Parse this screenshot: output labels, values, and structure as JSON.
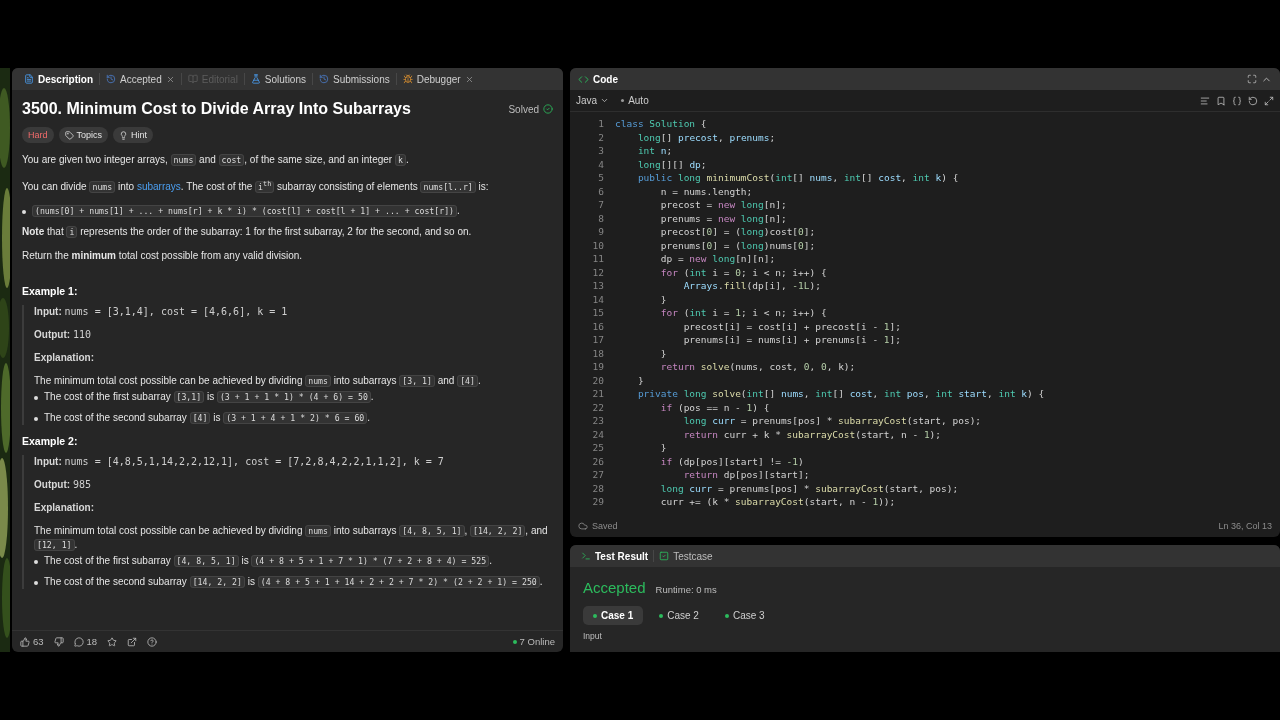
{
  "description_panel": {
    "tabs": [
      {
        "label": "Description",
        "selected": true,
        "disabled": false,
        "closable": false
      },
      {
        "label": "Accepted",
        "selected": false,
        "disabled": false,
        "closable": true
      },
      {
        "label": "Editorial",
        "selected": false,
        "disabled": true,
        "closable": false
      },
      {
        "label": "Solutions",
        "selected": false,
        "disabled": false,
        "closable": false
      },
      {
        "label": "Submissions",
        "selected": false,
        "disabled": false,
        "closable": false
      },
      {
        "label": "Debugger",
        "selected": false,
        "disabled": false,
        "closable": true
      }
    ],
    "title": "3500. Minimum Cost to Divide Array Into Subarrays",
    "status": "Solved",
    "tags": [
      {
        "label": "Hard",
        "kind": "difficulty"
      },
      {
        "label": "Topics",
        "kind": "topics"
      },
      {
        "label": "Hint",
        "kind": "hint"
      }
    ],
    "content": [
      {
        "kind": "paragraph",
        "parts": [
          {
            "kind": "text",
            "text": "You are given two integer arrays, "
          },
          {
            "kind": "code",
            "text": "nums"
          },
          {
            "kind": "text",
            "text": " and "
          },
          {
            "kind": "code",
            "text": "cost"
          },
          {
            "kind": "text",
            "text": ", of the same size, and an integer "
          },
          {
            "kind": "code",
            "text": "k"
          },
          {
            "kind": "text",
            "text": "."
          }
        ]
      },
      {
        "kind": "paragraph",
        "parts": [
          {
            "kind": "text",
            "text": "You can divide "
          },
          {
            "kind": "code",
            "text": "nums"
          },
          {
            "kind": "text",
            "text": " into "
          },
          {
            "kind": "link",
            "text": "subarrays"
          },
          {
            "kind": "text",
            "text": ". The cost of the "
          },
          {
            "kind": "code",
            "text": "i$^{th}$"
          },
          {
            "kind": "text",
            "text": " subarray consisting of elements "
          },
          {
            "kind": "code",
            "text": "nums[l..r]"
          },
          {
            "kind": "text",
            "text": " is:"
          }
        ]
      },
      {
        "kind": "bullet",
        "parts": [
          {
            "kind": "code",
            "text": "(nums[0] + nums[1] + ... + nums[r] + k * i) * (cost[l] + cost[l + 1] + ... + cost[r])"
          },
          {
            "kind": "text",
            "text": "."
          }
        ]
      },
      {
        "kind": "paragraph",
        "parts": [
          {
            "kind": "text",
            "text": "**Note** that "
          },
          {
            "kind": "code",
            "text": "i"
          },
          {
            "kind": "text",
            "text": " represents the order of the subarray: 1 for the first subarray, 2 for the second, and so on."
          }
        ]
      },
      {
        "kind": "paragraph",
        "parts": [
          {
            "kind": "text",
            "text": "Return the **minimum** total cost possible from any valid division."
          }
        ]
      }
    ],
    "examples": [
      {
        "title": "Example 1:",
        "input_label": "Input:",
        "input": "nums = [3,1,4], cost = [4,6,6], k = 1",
        "output_label": "Output:",
        "output": "110",
        "explanation_label": "Explanation:",
        "explanation": [
          {
            "kind": "text",
            "text": "The minimum total cost possible can be achieved by dividing "
          },
          {
            "kind": "code",
            "text": "nums"
          },
          {
            "kind": "text",
            "text": " into subarrays "
          },
          {
            "kind": "code",
            "text": "[3, 1]"
          },
          {
            "kind": "text",
            "text": " and "
          },
          {
            "kind": "code",
            "text": "[4]"
          },
          {
            "kind": "text",
            "text": "."
          }
        ],
        "bullets": [
          [
            {
              "kind": "text",
              "text": "The cost of the first subarray "
            },
            {
              "kind": "code",
              "text": "[3,1]"
            },
            {
              "kind": "text",
              "text": " is "
            },
            {
              "kind": "code",
              "text": "(3 + 1 + 1 * 1) * (4 + 6) = 50"
            },
            {
              "kind": "text",
              "text": "."
            }
          ],
          [
            {
              "kind": "text",
              "text": "The cost of the second subarray "
            },
            {
              "kind": "code",
              "text": "[4]"
            },
            {
              "kind": "text",
              "text": " is "
            },
            {
              "kind": "code",
              "text": "(3 + 1 + 4 + 1 * 2) * 6 = 60"
            },
            {
              "kind": "text",
              "text": "."
            }
          ]
        ]
      },
      {
        "title": "Example 2:",
        "input_label": "Input:",
        "input": "nums = [4,8,5,1,14,2,2,12,1], cost = [7,2,8,4,2,2,1,1,2], k = 7",
        "output_label": "Output:",
        "output": "985",
        "explanation_label": "Explanation:",
        "explanation": [
          {
            "kind": "text",
            "text": "The minimum total cost possible can be achieved by dividing "
          },
          {
            "kind": "code",
            "text": "nums"
          },
          {
            "kind": "text",
            "text": " into subarrays "
          },
          {
            "kind": "code",
            "text": "[4, 8, 5, 1]"
          },
          {
            "kind": "text",
            "text": ", "
          },
          {
            "kind": "code",
            "text": "[14, 2, 2]"
          },
          {
            "kind": "text",
            "text": ", and "
          },
          {
            "kind": "code",
            "text": "[12, 1]"
          },
          {
            "kind": "text",
            "text": "."
          }
        ],
        "bullets": [
          [
            {
              "kind": "text",
              "text": "The cost of the first subarray "
            },
            {
              "kind": "code",
              "text": "[4, 8, 5, 1]"
            },
            {
              "kind": "text",
              "text": " is "
            },
            {
              "kind": "code",
              "text": "(4 + 8 + 5 + 1 + 7 * 1) * (7 + 2 + 8 + 4) = 525"
            },
            {
              "kind": "text",
              "text": "."
            }
          ],
          [
            {
              "kind": "text",
              "text": "The cost of the second subarray "
            },
            {
              "kind": "code",
              "text": "[14, 2, 2]"
            },
            {
              "kind": "text",
              "text": " is "
            },
            {
              "kind": "code",
              "text": "(4 + 8 + 5 + 1 + 14 + 2 + 2 + 7 * 2) * (2 + 2 + 1) = 250"
            },
            {
              "kind": "text",
              "text": "."
            }
          ]
        ]
      }
    ],
    "footer": {
      "likes": "63",
      "comments": "18",
      "online": "7 Online"
    }
  },
  "editor": {
    "title": "Code",
    "language": "Java",
    "mode": "Auto",
    "lines": [
      {
        "number": "1",
        "tokens": [
          {
            "kind": "kw",
            "text": "class"
          },
          {
            "kind": "type",
            "text": " Solution"
          },
          {
            "kind": "p",
            "text": " {"
          }
        ]
      },
      {
        "number": "2",
        "tokens": [
          {
            "kind": "type",
            "text": "    long"
          },
          {
            "kind": "p",
            "text": "[] "
          },
          {
            "kind": "var",
            "text": "precost"
          },
          {
            "kind": "p",
            "text": ", "
          },
          {
            "kind": "var",
            "text": "prenums"
          },
          {
            "kind": "p",
            "text": ";"
          }
        ]
      },
      {
        "number": "3",
        "tokens": [
          {
            "kind": "type",
            "text": "    int"
          },
          {
            "kind": "var",
            "text": " n"
          },
          {
            "kind": "p",
            "text": ";"
          }
        ]
      },
      {
        "number": "4",
        "tokens": [
          {
            "kind": "type",
            "text": "    long"
          },
          {
            "kind": "p",
            "text": "[][] "
          },
          {
            "kind": "var",
            "text": "dp"
          },
          {
            "kind": "p",
            "text": ";"
          }
        ]
      },
      {
        "number": "5",
        "tokens": [
          {
            "kind": "kw",
            "text": "    public"
          },
          {
            "kind": "type",
            "text": " long"
          },
          {
            "kind": "fn",
            "text": " minimumCost"
          },
          {
            "kind": "p",
            "text": "("
          },
          {
            "kind": "type",
            "text": "int"
          },
          {
            "kind": "p",
            "text": "[] "
          },
          {
            "kind": "var",
            "text": "nums"
          },
          {
            "kind": "p",
            "text": ", "
          },
          {
            "kind": "type",
            "text": "int"
          },
          {
            "kind": "p",
            "text": "[] "
          },
          {
            "kind": "var",
            "text": "cost"
          },
          {
            "kind": "p",
            "text": ", "
          },
          {
            "kind": "type",
            "text": "int"
          },
          {
            "kind": "var",
            "text": " k"
          },
          {
            "kind": "p",
            "text": ") {"
          }
        ]
      },
      {
        "number": "6",
        "tokens": [
          {
            "kind": "p",
            "text": "        n = nums.length;"
          }
        ]
      },
      {
        "number": "7",
        "tokens": [
          {
            "kind": "p",
            "text": "        precost = "
          },
          {
            "kind": "ctl",
            "text": "new"
          },
          {
            "kind": "type",
            "text": " long"
          },
          {
            "kind": "p",
            "text": "[n];"
          }
        ]
      },
      {
        "number": "8",
        "tokens": [
          {
            "kind": "p",
            "text": "        prenums = "
          },
          {
            "kind": "ctl",
            "text": "new"
          },
          {
            "kind": "type",
            "text": " long"
          },
          {
            "kind": "p",
            "text": "[n];"
          }
        ]
      },
      {
        "number": "9",
        "tokens": [
          {
            "kind": "p",
            "text": "        precost["
          },
          {
            "kind": "num",
            "text": "0"
          },
          {
            "kind": "p",
            "text": "] = ("
          },
          {
            "kind": "type",
            "text": "long"
          },
          {
            "kind": "p",
            "text": ")cost["
          },
          {
            "kind": "num",
            "text": "0"
          },
          {
            "kind": "p",
            "text": "];"
          }
        ]
      },
      {
        "number": "10",
        "tokens": [
          {
            "kind": "p",
            "text": "        prenums["
          },
          {
            "kind": "num",
            "text": "0"
          },
          {
            "kind": "p",
            "text": "] = ("
          },
          {
            "kind": "type",
            "text": "long"
          },
          {
            "kind": "p",
            "text": ")nums["
          },
          {
            "kind": "num",
            "text": "0"
          },
          {
            "kind": "p",
            "text": "];"
          }
        ]
      },
      {
        "number": "11",
        "tokens": [
          {
            "kind": "p",
            "text": "        dp = "
          },
          {
            "kind": "ctl",
            "text": "new"
          },
          {
            "kind": "type",
            "text": " long"
          },
          {
            "kind": "p",
            "text": "[n][n];"
          }
        ]
      },
      {
        "number": "12",
        "tokens": [
          {
            "kind": "ctl",
            "text": "        for"
          },
          {
            "kind": "p",
            "text": " ("
          },
          {
            "kind": "type",
            "text": "int"
          },
          {
            "kind": "p",
            "text": " i = "
          },
          {
            "kind": "num",
            "text": "0"
          },
          {
            "kind": "p",
            "text": "; i < n; i++) {"
          }
        ]
      },
      {
        "number": "13",
        "tokens": [
          {
            "kind": "var",
            "text": "            Arrays"
          },
          {
            "kind": "p",
            "text": "."
          },
          {
            "kind": "fn",
            "text": "fill"
          },
          {
            "kind": "p",
            "text": "(dp[i], "
          },
          {
            "kind": "num",
            "text": "-1L"
          },
          {
            "kind": "p",
            "text": ");"
          }
        ]
      },
      {
        "number": "14",
        "tokens": [
          {
            "kind": "p",
            "text": "        }"
          }
        ]
      },
      {
        "number": "15",
        "tokens": [
          {
            "kind": "ctl",
            "text": "        for"
          },
          {
            "kind": "p",
            "text": " ("
          },
          {
            "kind": "type",
            "text": "int"
          },
          {
            "kind": "p",
            "text": " i = "
          },
          {
            "kind": "num",
            "text": "1"
          },
          {
            "kind": "p",
            "text": "; i < n; i++) {"
          }
        ]
      },
      {
        "number": "16",
        "tokens": [
          {
            "kind": "p",
            "text": "            precost[i] = cost[i] + precost[i - "
          },
          {
            "kind": "num",
            "text": "1"
          },
          {
            "kind": "p",
            "text": "];"
          }
        ]
      },
      {
        "number": "17",
        "tokens": [
          {
            "kind": "p",
            "text": "            prenums[i] = nums[i] + prenums[i - "
          },
          {
            "kind": "num",
            "text": "1"
          },
          {
            "kind": "p",
            "text": "];"
          }
        ]
      },
      {
        "number": "18",
        "tokens": [
          {
            "kind": "p",
            "text": "        }"
          }
        ]
      },
      {
        "number": "19",
        "tokens": [
          {
            "kind": "ctl",
            "text": "        return"
          },
          {
            "kind": "fn",
            "text": " solve"
          },
          {
            "kind": "p",
            "text": "(nums, cost, "
          },
          {
            "kind": "num",
            "text": "0"
          },
          {
            "kind": "p",
            "text": ", "
          },
          {
            "kind": "num",
            "text": "0"
          },
          {
            "kind": "p",
            "text": ", k);"
          }
        ]
      },
      {
        "number": "20",
        "tokens": [
          {
            "kind": "p",
            "text": "    }"
          }
        ]
      },
      {
        "number": "21",
        "tokens": [
          {
            "kind": "kw",
            "text": "    private"
          },
          {
            "kind": "type",
            "text": " long"
          },
          {
            "kind": "fn",
            "text": " solve"
          },
          {
            "kind": "p",
            "text": "("
          },
          {
            "kind": "type",
            "text": "int"
          },
          {
            "kind": "p",
            "text": "[] "
          },
          {
            "kind": "var",
            "text": "nums"
          },
          {
            "kind": "p",
            "text": ", "
          },
          {
            "kind": "type",
            "text": "int"
          },
          {
            "kind": "p",
            "text": "[] "
          },
          {
            "kind": "var",
            "text": "cost"
          },
          {
            "kind": "p",
            "text": ", "
          },
          {
            "kind": "type",
            "text": "int"
          },
          {
            "kind": "var",
            "text": " pos"
          },
          {
            "kind": "p",
            "text": ", "
          },
          {
            "kind": "type",
            "text": "int"
          },
          {
            "kind": "var",
            "text": " start"
          },
          {
            "kind": "p",
            "text": ", "
          },
          {
            "kind": "type",
            "text": "int"
          },
          {
            "kind": "var",
            "text": " k"
          },
          {
            "kind": "p",
            "text": ") {"
          }
        ]
      },
      {
        "number": "22",
        "tokens": [
          {
            "kind": "ctl",
            "text": "        if"
          },
          {
            "kind": "p",
            "text": " (pos == n - "
          },
          {
            "kind": "num",
            "text": "1"
          },
          {
            "kind": "p",
            "text": ") {"
          }
        ]
      },
      {
        "number": "23",
        "tokens": [
          {
            "kind": "type",
            "text": "            long"
          },
          {
            "kind": "var",
            "text": " curr"
          },
          {
            "kind": "p",
            "text": " = prenums[pos] * "
          },
          {
            "kind": "fn",
            "text": "subarrayCost"
          },
          {
            "kind": "p",
            "text": "(start, pos);"
          }
        ]
      },
      {
        "number": "24",
        "tokens": [
          {
            "kind": "ctl",
            "text": "            return"
          },
          {
            "kind": "p",
            "text": " curr + k * "
          },
          {
            "kind": "fn",
            "text": "subarrayCost"
          },
          {
            "kind": "p",
            "text": "(start, n - "
          },
          {
            "kind": "num",
            "text": "1"
          },
          {
            "kind": "p",
            "text": ");"
          }
        ]
      },
      {
        "number": "25",
        "tokens": [
          {
            "kind": "p",
            "text": "        }"
          }
        ]
      },
      {
        "number": "26",
        "tokens": [
          {
            "kind": "ctl",
            "text": "        if"
          },
          {
            "kind": "p",
            "text": " (dp[pos][start] != "
          },
          {
            "kind": "num",
            "text": "-1"
          },
          {
            "kind": "p",
            "text": ")"
          }
        ]
      },
      {
        "number": "27",
        "tokens": [
          {
            "kind": "ctl",
            "text": "            return"
          },
          {
            "kind": "p",
            "text": " dp[pos][start];"
          }
        ]
      },
      {
        "number": "28",
        "tokens": [
          {
            "kind": "type",
            "text": "        long"
          },
          {
            "kind": "var",
            "text": " curr"
          },
          {
            "kind": "p",
            "text": " = prenums[pos] * "
          },
          {
            "kind": "fn",
            "text": "subarrayCost"
          },
          {
            "kind": "p",
            "text": "(start, pos);"
          }
        ]
      },
      {
        "number": "29",
        "tokens": [
          {
            "kind": "p",
            "text": "        curr += (k * "
          },
          {
            "kind": "fn",
            "text": "subarrayCost"
          },
          {
            "kind": "p",
            "text": "(start, n - "
          },
          {
            "kind": "num",
            "text": "1"
          },
          {
            "kind": "p",
            "text": "));"
          }
        ]
      }
    ],
    "status": "Saved",
    "cursor": "Ln 36, Col 13"
  },
  "results": {
    "tabs": [
      {
        "label": "Test Result",
        "selected": true
      },
      {
        "label": "Testcase",
        "selected": false
      }
    ],
    "verdict": "Accepted",
    "runtime": "Runtime: 0 ms",
    "cases": [
      {
        "label": "Case 1",
        "selected": true
      },
      {
        "label": "Case 2",
        "selected": false
      },
      {
        "label": "Case 3",
        "selected": false
      }
    ],
    "input_label": "Input"
  }
}
